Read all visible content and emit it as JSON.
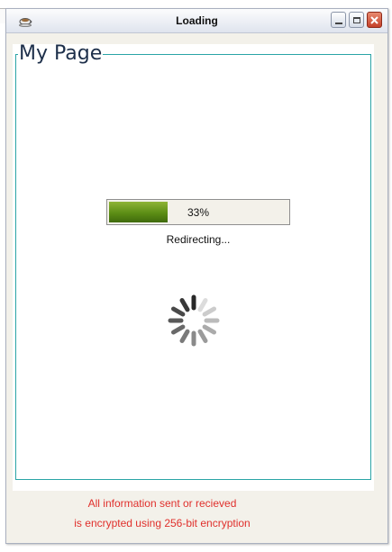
{
  "window": {
    "title": "Loading",
    "icon": "teacup-app-icon",
    "controls": [
      "minimize",
      "maximize",
      "close"
    ]
  },
  "group": {
    "legend": "My Page"
  },
  "progress": {
    "value_text": "33%",
    "fraction": 0.33
  },
  "status": {
    "text": "Redirecting..."
  },
  "spinner": {
    "icon": "loading-spinner-icon"
  },
  "footer": {
    "line1": "All information sent or recieved",
    "line2": "is encrypted using 256-bit encryption"
  },
  "colors": {
    "frame_accent": "#2aa4a6",
    "progress_green": "#5c8d15",
    "footer_red": "#e0302c"
  }
}
